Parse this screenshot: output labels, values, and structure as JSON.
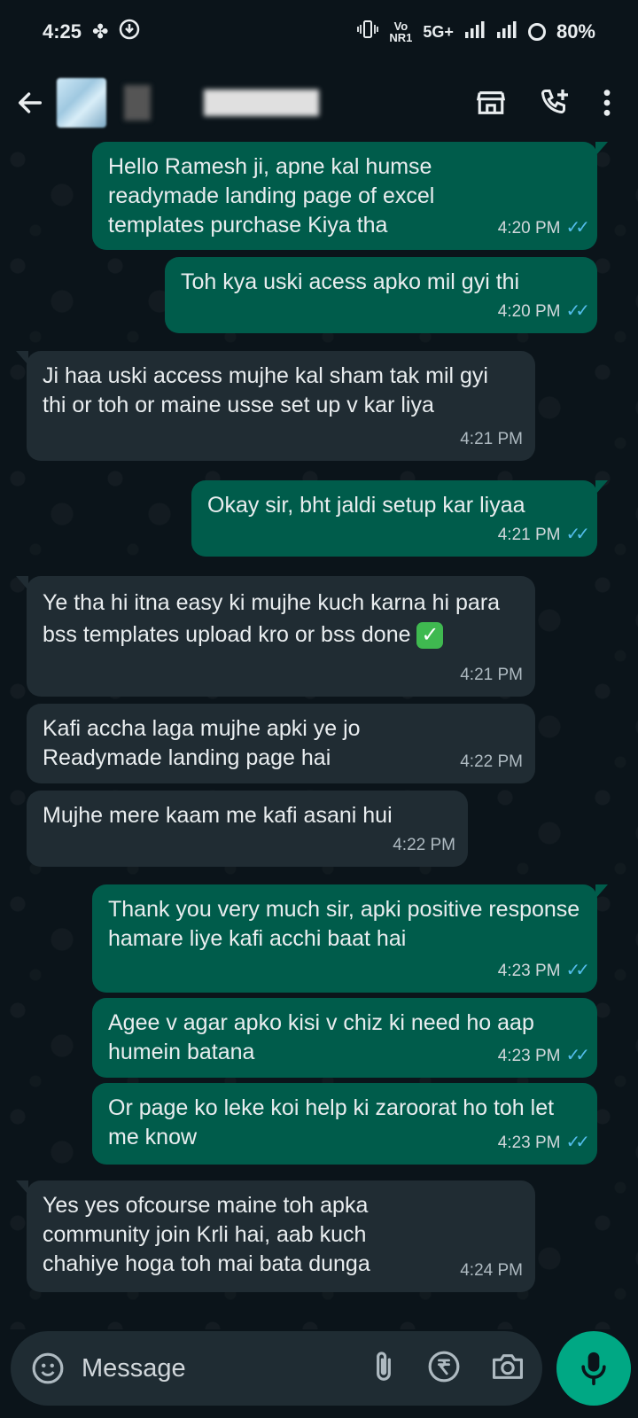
{
  "status_bar": {
    "time": "4:25",
    "network_label_top": "Vo",
    "network_label_bottom": "NR1",
    "network_type": "5G+",
    "battery": "80%"
  },
  "header": {
    "icons": [
      "back-arrow-icon",
      "store-icon",
      "add-call-icon",
      "more-options-icon"
    ]
  },
  "messages": [
    {
      "dir": "out",
      "text": "Hello Ramesh ji, apne kal humse readymade landing page of excel templates purchase Kiya tha",
      "time": "4:20 PM"
    },
    {
      "dir": "out",
      "text": "Toh kya uski acess apko mil gyi thi",
      "time": "4:20 PM"
    },
    {
      "dir": "in",
      "text": "Ji haa uski access mujhe kal sham tak mil gyi thi or toh or maine usse set up v kar liya",
      "time": "4:21 PM"
    },
    {
      "dir": "out",
      "text": "Okay sir, bht jaldi setup kar liyaa",
      "time": "4:21 PM"
    },
    {
      "dir": "in",
      "text": "Ye tha hi itna easy ki mujhe kuch karna hi para bss templates upload kro or bss done",
      "time": "4:21 PM"
    },
    {
      "dir": "in",
      "text": "Kafi accha laga mujhe apki ye jo Readymade landing page hai",
      "time": "4:22 PM"
    },
    {
      "dir": "in",
      "text": "Mujhe mere kaam me kafi asani hui",
      "time": "4:22 PM"
    },
    {
      "dir": "out",
      "text": "Thank you very much sir, apki positive response hamare liye kafi acchi baat hai",
      "time": "4:23 PM"
    },
    {
      "dir": "out",
      "text": "Agee v agar apko kisi v chiz ki need ho aap humein batana",
      "time": "4:23 PM"
    },
    {
      "dir": "out",
      "text": "Or page ko leke koi help ki zaroorat ho toh let me know",
      "time": "4:23 PM"
    },
    {
      "dir": "in",
      "text": "Yes yes ofcourse maine toh apka community join Krli hai, aab kuch chahiye hoga toh mai bata dunga",
      "time": "4:24 PM"
    }
  ],
  "input": {
    "placeholder": "Message"
  },
  "colors": {
    "background": "#0b141a",
    "outgoing_bubble": "#005c4b",
    "incoming_bubble": "#202c33",
    "read_ticks": "#53bdeb",
    "mic_button": "#00a884"
  }
}
